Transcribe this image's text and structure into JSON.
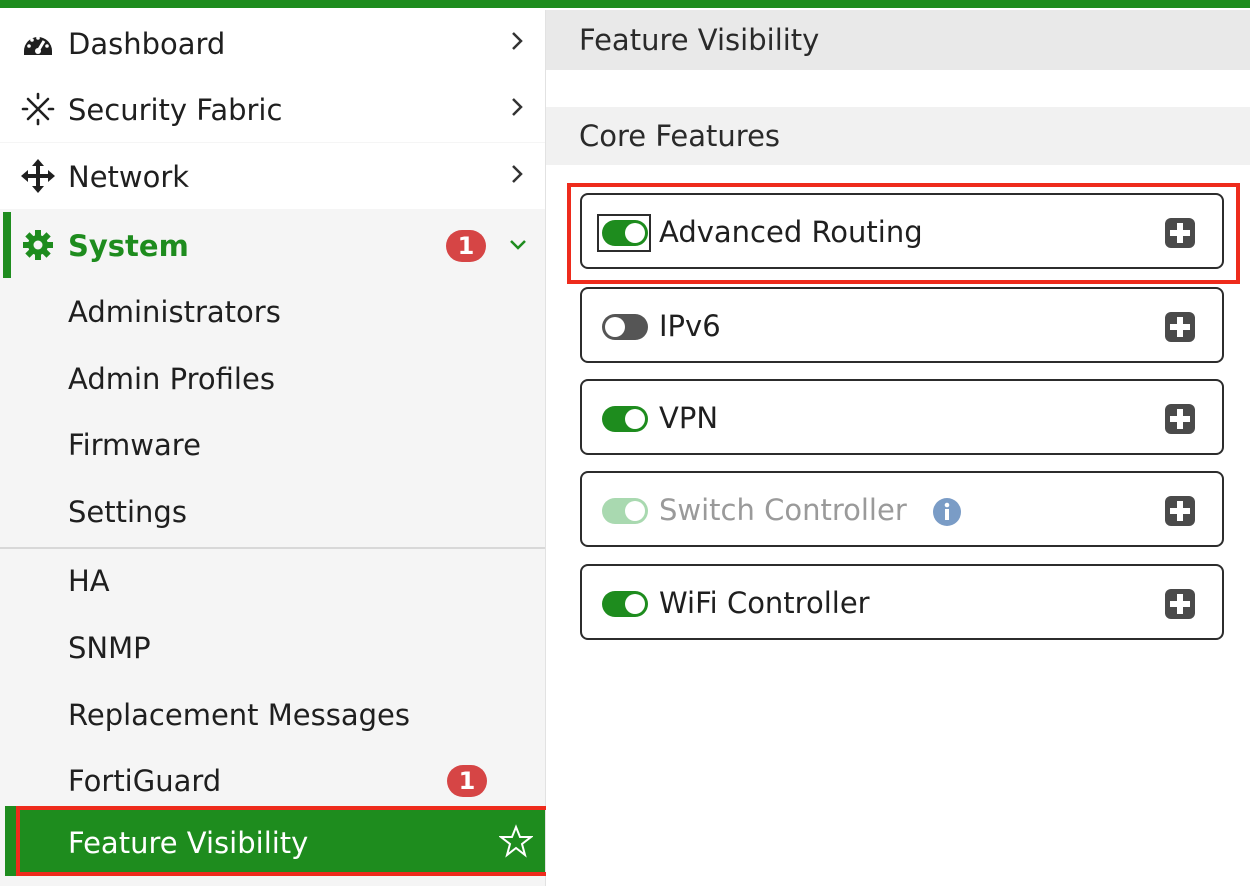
{
  "sidebar": {
    "dashboard": {
      "label": "Dashboard",
      "icon": "dashboard-icon"
    },
    "security_fabric": {
      "label": "Security Fabric",
      "icon": "security-fabric-icon"
    },
    "network": {
      "label": "Network",
      "icon": "network-icon"
    },
    "system": {
      "label": "System",
      "icon": "gear-icon",
      "badge": "1",
      "expanded": true,
      "children": [
        {
          "label": "Administrators"
        },
        {
          "label": "Admin Profiles"
        },
        {
          "label": "Firmware"
        },
        {
          "label": "Settings"
        },
        {
          "label": "HA"
        },
        {
          "label": "SNMP"
        },
        {
          "label": "Replacement Messages"
        },
        {
          "label": "FortiGuard",
          "badge": "1"
        },
        {
          "label": "Feature Visibility",
          "active": true
        }
      ]
    }
  },
  "main": {
    "page_title": "Feature Visibility",
    "section_title": "Core Features",
    "features": [
      {
        "label": "Advanced Routing",
        "state": "on"
      },
      {
        "label": "IPv6",
        "state": "off"
      },
      {
        "label": "VPN",
        "state": "on"
      },
      {
        "label": "Switch Controller",
        "state": "on-disabled",
        "info": true
      },
      {
        "label": "WiFi Controller",
        "state": "on"
      }
    ]
  },
  "colors": {
    "brand_green": "#1e8c1e",
    "badge_red": "#d64545",
    "highlight_red": "#ee2b1c"
  }
}
